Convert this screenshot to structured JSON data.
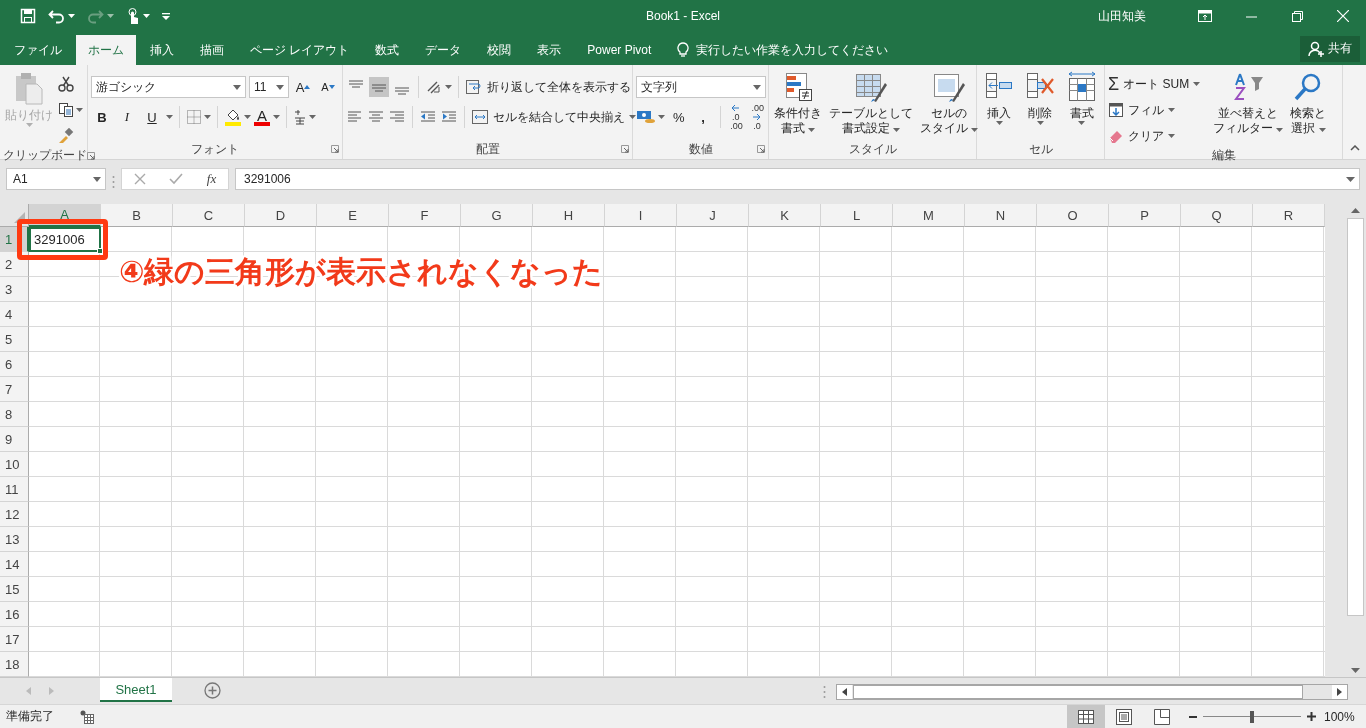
{
  "window": {
    "title": "Book1 - Excel",
    "user": "山田知美"
  },
  "tabs": [
    {
      "label": "ファイル",
      "selected": false
    },
    {
      "label": "ホーム",
      "selected": true
    },
    {
      "label": "挿入",
      "selected": false
    },
    {
      "label": "描画",
      "selected": false
    },
    {
      "label": "ページ レイアウト",
      "selected": false
    },
    {
      "label": "数式",
      "selected": false
    },
    {
      "label": "データ",
      "selected": false
    },
    {
      "label": "校閲",
      "selected": false
    },
    {
      "label": "表示",
      "selected": false
    },
    {
      "label": "Power Pivot",
      "selected": false
    }
  ],
  "tell_me": {
    "placeholder": "実行したい作業を入力してください"
  },
  "share_button": "共有",
  "ribbon": {
    "groups": [
      {
        "label": "クリップボード",
        "launcher": true,
        "paste": {
          "label": "貼り付け",
          "disabled": true
        }
      },
      {
        "label": "フォント",
        "launcher": true,
        "font_name": "游ゴシック",
        "font_size": "11",
        "grow": "A",
        "shrink": "A",
        "styles": [
          "B",
          "I",
          "U"
        ],
        "font_color": "A"
      },
      {
        "label": "配置",
        "launcher": true,
        "vertical_align": [
          {
            "selected": false
          },
          {
            "selected": true
          },
          {
            "selected": false
          }
        ],
        "wrap_text": "折り返して全体を表示する",
        "merge": "セルを結合して中央揃え"
      },
      {
        "label": "数値",
        "launcher": true,
        "format": "文字列",
        "percent": "%",
        "comma": ",",
        "decimals": [
          {
            "top": ".0",
            "bottom": ".00"
          },
          {
            "top": ".00",
            "bottom": ".0"
          }
        ]
      },
      {
        "label": "スタイル",
        "buttons": [
          {
            "kind": "conditional",
            "lines": [
              "条件付き",
              "書式"
            ]
          },
          {
            "kind": "table",
            "lines": [
              "テーブルとして",
              "書式設定"
            ]
          },
          {
            "kind": "cellstyle",
            "lines": [
              "セルの",
              "スタイル"
            ]
          }
        ]
      },
      {
        "label": "セル",
        "buttons": [
          {
            "kind": "insert",
            "lines": [
              "挿入"
            ]
          },
          {
            "kind": "delete",
            "lines": [
              "削除"
            ]
          },
          {
            "kind": "format",
            "lines": [
              "書式"
            ]
          }
        ]
      },
      {
        "label": "編集",
        "small": [
          {
            "kind": "sum",
            "symbol": "Σ",
            "label": "オート SUM"
          },
          {
            "kind": "fill",
            "label": "フィル"
          },
          {
            "kind": "clear",
            "label": "クリア"
          }
        ],
        "buttons": [
          {
            "kind": "sort",
            "lines": [
              "並べ替えと",
              "フィルター"
            ]
          },
          {
            "kind": "find",
            "lines": [
              "検索と",
              "選択"
            ]
          }
        ]
      }
    ]
  },
  "formula_bar": {
    "name_box": "A1",
    "function_label": "fx",
    "value": "3291006"
  },
  "sheet": {
    "columns": [
      {
        "label": "A",
        "selected": true
      },
      {
        "label": "B",
        "selected": false
      },
      {
        "label": "C",
        "selected": false
      },
      {
        "label": "D",
        "selected": false
      },
      {
        "label": "E",
        "selected": false
      },
      {
        "label": "F",
        "selected": false
      },
      {
        "label": "G",
        "selected": false
      },
      {
        "label": "H",
        "selected": false
      },
      {
        "label": "I",
        "selected": false
      },
      {
        "label": "J",
        "selected": false
      },
      {
        "label": "K",
        "selected": false
      },
      {
        "label": "L",
        "selected": false
      },
      {
        "label": "M",
        "selected": false
      },
      {
        "label": "N",
        "selected": false
      },
      {
        "label": "O",
        "selected": false
      },
      {
        "label": "P",
        "selected": false
      },
      {
        "label": "Q",
        "selected": false
      },
      {
        "label": "R",
        "selected": false
      }
    ],
    "rows": [
      {
        "header": "1",
        "selected": true,
        "cells": [
          {
            "value": "3291006",
            "selected": true
          }
        ]
      },
      {
        "header": "2",
        "selected": false
      },
      {
        "header": "3",
        "selected": false
      },
      {
        "header": "4",
        "selected": false
      },
      {
        "header": "5",
        "selected": false
      },
      {
        "header": "6",
        "selected": false
      },
      {
        "header": "7",
        "selected": false
      },
      {
        "header": "8",
        "selected": false
      },
      {
        "header": "9",
        "selected": false
      },
      {
        "header": "10",
        "selected": false
      },
      {
        "header": "11",
        "selected": false
      },
      {
        "header": "12",
        "selected": false
      },
      {
        "header": "13",
        "selected": false
      },
      {
        "header": "14",
        "selected": false
      },
      {
        "header": "15",
        "selected": false
      },
      {
        "header": "16",
        "selected": false
      },
      {
        "header": "17",
        "selected": false
      },
      {
        "header": "18",
        "selected": false
      }
    ]
  },
  "callout": {
    "text": "④緑の三角形が表示されなくなった"
  },
  "sheet_tabs": [
    {
      "label": "Sheet1",
      "selected": true
    }
  ],
  "status_bar": {
    "text": "準備完了",
    "views": [
      {
        "selected": true
      },
      {
        "selected": false
      },
      {
        "selected": false
      }
    ],
    "zoom": {
      "level": 0.5
    },
    "zoom_text": "100%"
  }
}
